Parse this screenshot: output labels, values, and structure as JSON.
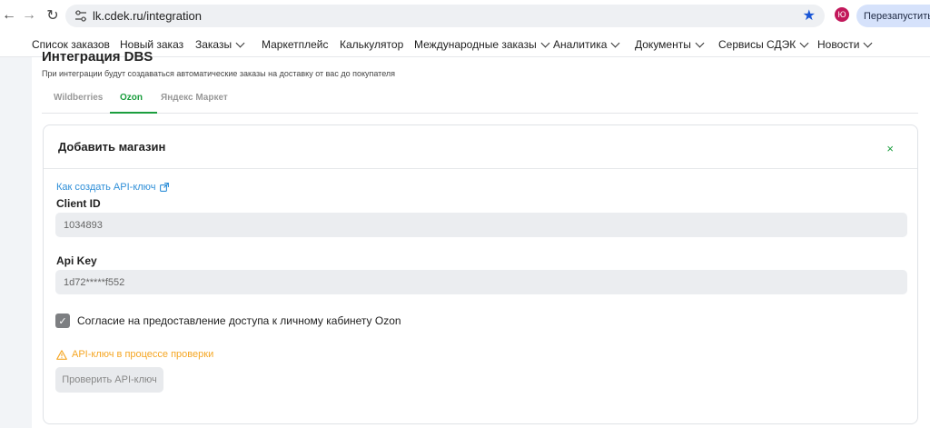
{
  "browser": {
    "url": "lk.cdek.ru/integration",
    "avatar_letter": "Ю",
    "restart_label": "Перезапустить и обновить"
  },
  "sitenav": {
    "items": [
      {
        "label": "Список заказов",
        "dropdown": false
      },
      {
        "label": "Новый заказ",
        "dropdown": false
      },
      {
        "label": "Заказы",
        "dropdown": true
      },
      {
        "label": "Маркетплейс",
        "dropdown": false
      },
      {
        "label": "Калькулятор",
        "dropdown": false
      },
      {
        "label": "Международные заказы",
        "dropdown": true
      },
      {
        "label": "Аналитика",
        "dropdown": true
      },
      {
        "label": "Документы",
        "dropdown": true
      },
      {
        "label": "Сервисы СДЭК",
        "dropdown": true
      },
      {
        "label": "Новости",
        "dropdown": true
      }
    ]
  },
  "page": {
    "title": "Интеграция DBS",
    "description": "При интеграции будут создаваться автоматические заказы на доставку от вас до покупателя",
    "tabs": [
      {
        "label": "Wildberries",
        "active": false
      },
      {
        "label": "Ozon",
        "active": true
      },
      {
        "label": "Яндекс Маркет",
        "active": false
      }
    ]
  },
  "card": {
    "title": "Добавить магазин",
    "close_symbol": "×",
    "api_link": "Как создать API-ключ",
    "client_id_label": "Client ID",
    "client_id_value": "1034893",
    "api_key_label": "Api Key",
    "api_key_value": "1d72*****f552",
    "consent_checked": true,
    "consent_label": "Согласие на предоставление доступа к личному кабинету Ozon",
    "warning": "API-ключ в процессе проверки",
    "verify_button": "Проверить API-ключ"
  },
  "colors": {
    "accent": "#1b9e3e",
    "link": "#2f8fd8",
    "warning": "#f5a623"
  }
}
